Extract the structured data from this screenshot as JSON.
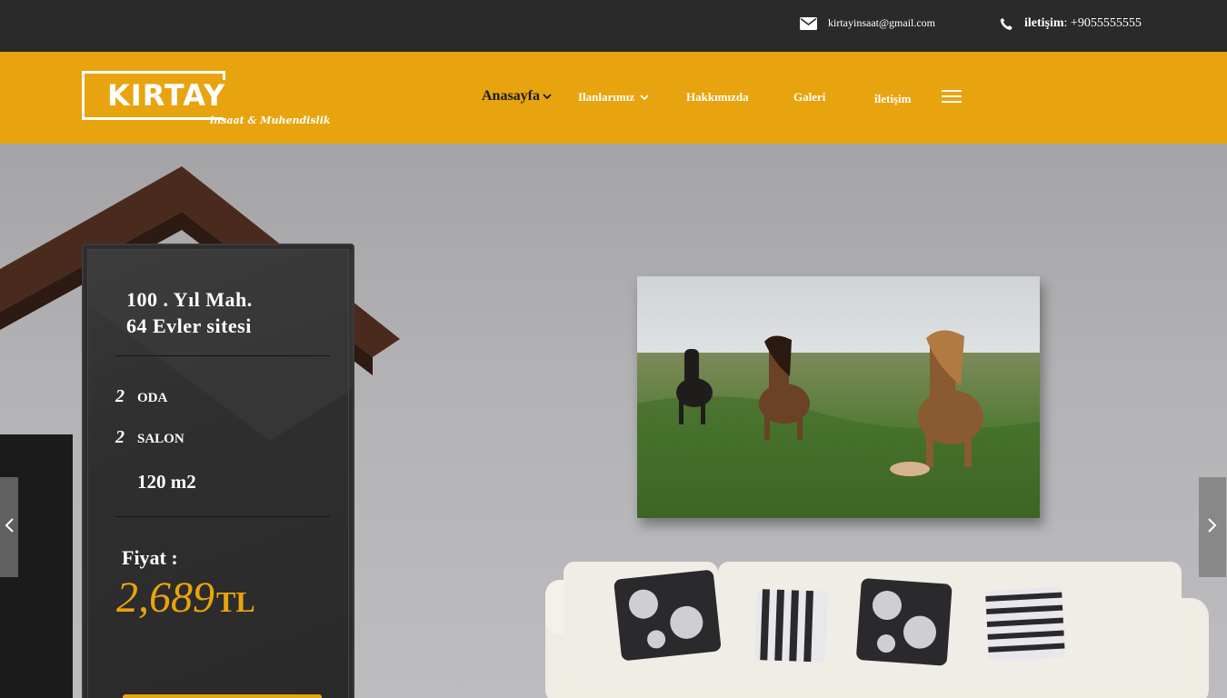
{
  "topbar": {
    "email": "kirtayinsaat@gmail.com",
    "phone_label": "iletişim",
    "phone_number": " : +9055555555",
    "email_icon": "envelope-icon",
    "phone_icon": "phone-icon"
  },
  "logo": {
    "name": "KIRTAY",
    "tagline": "insaat & Muhendislik"
  },
  "nav": {
    "items": [
      {
        "label": "Anasayfa",
        "has_dropdown": true,
        "active": true
      },
      {
        "label": "Ilanlarımız",
        "has_dropdown": true,
        "active": false
      },
      {
        "label": "Hakkımızda",
        "has_dropdown": false,
        "active": false
      },
      {
        "label": "Galeri",
        "has_dropdown": false,
        "active": false
      },
      {
        "label": "iletişim",
        "has_dropdown": false,
        "active": false
      }
    ],
    "menu_icon": "hamburger-icon"
  },
  "listing": {
    "address_line1": "100 . Yıl Mah.",
    "address_line2": "64 Evler sitesi",
    "rooms_count": "2",
    "rooms_label": "ODA",
    "salon_count": "2",
    "salon_label": "SALON",
    "area": "120 m2",
    "price_label": "Fiyat :",
    "price_value": "2,689",
    "price_currency": "TL"
  },
  "slider": {
    "prev_icon": "chevron-left-icon",
    "next_icon": "chevron-right-icon"
  },
  "colors": {
    "accent": "#e8a40e",
    "topbar_bg": "#2a2a2a",
    "card_bg": "#2d2d2d"
  }
}
